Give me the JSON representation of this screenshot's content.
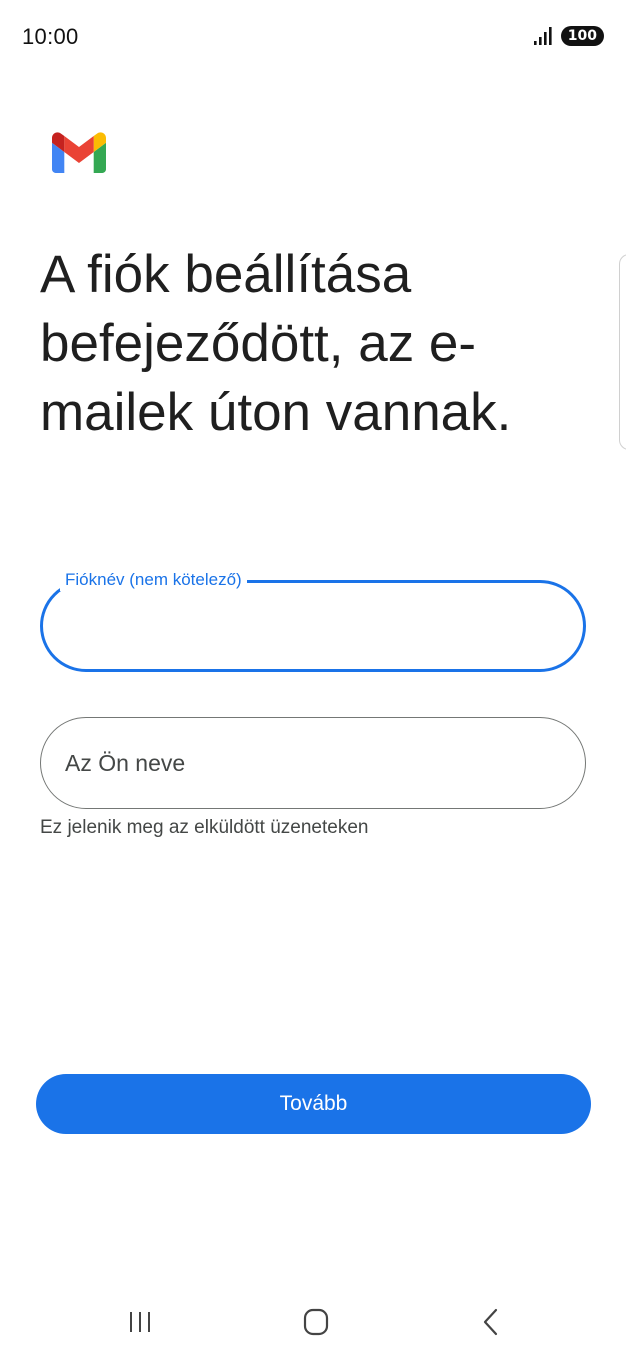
{
  "status_bar": {
    "time": "10:00",
    "battery": "100",
    "signal_icon": "signal-bars-icon"
  },
  "logo": {
    "name": "gmail-logo",
    "colors": [
      "#4285F4",
      "#EA4335",
      "#FBBC04",
      "#34A853",
      "#C5221F"
    ]
  },
  "title": "A fiók beállítása befejeződött, az e-mailek úton vannak.",
  "form": {
    "account_name": {
      "label": "Fióknév (nem kötelező)",
      "value": ""
    },
    "your_name": {
      "placeholder": "Az Ön neve",
      "value": "",
      "helper": "Ez jelenik meg az elküldött üzeneteken"
    }
  },
  "next_button": {
    "label": "Tovább"
  },
  "colors": {
    "accent": "#1a73e8",
    "text": "#1f1f1f",
    "secondary_text": "#444746",
    "outline": "#747775"
  },
  "nav_bar": {
    "recents_icon": "recents-icon",
    "home_icon": "home-icon",
    "back_icon": "back-icon"
  }
}
